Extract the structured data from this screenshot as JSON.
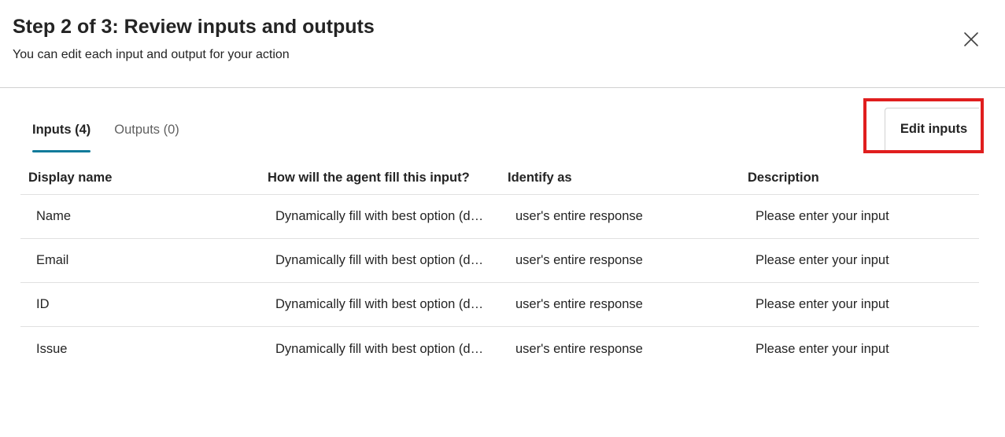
{
  "dialog": {
    "title": "Step 2 of 3: Review inputs and outputs",
    "subtitle": "You can edit each input and output for your action",
    "close_icon": "close-icon"
  },
  "tabs": [
    {
      "label": "Inputs (4)",
      "active": true
    },
    {
      "label": "Outputs (0)",
      "active": false
    }
  ],
  "toolbar": {
    "edit_label": "Edit inputs",
    "highlight_color": "#e01e1e"
  },
  "table": {
    "headers": [
      "Display name",
      "How will the agent fill this input?",
      "Identify as",
      "Description"
    ],
    "rows": [
      {
        "name": "Name",
        "fill": "Dynamically fill with best option (default)",
        "identify": "user's entire response",
        "description": "Please enter your input"
      },
      {
        "name": "Email",
        "fill": "Dynamically fill with best option (default)",
        "identify": "user's entire response",
        "description": "Please enter your input"
      },
      {
        "name": "ID",
        "fill": "Dynamically fill with best option (default)",
        "identify": "user's entire response",
        "description": "Please enter your input"
      },
      {
        "name": "Issue",
        "fill": "Dynamically fill with best option (default)",
        "identify": "user's entire response",
        "description": "Please enter your input"
      }
    ]
  },
  "colors": {
    "tab_indicator": "#117b9a",
    "divider": "#e0e0e0",
    "text": "#242424"
  }
}
